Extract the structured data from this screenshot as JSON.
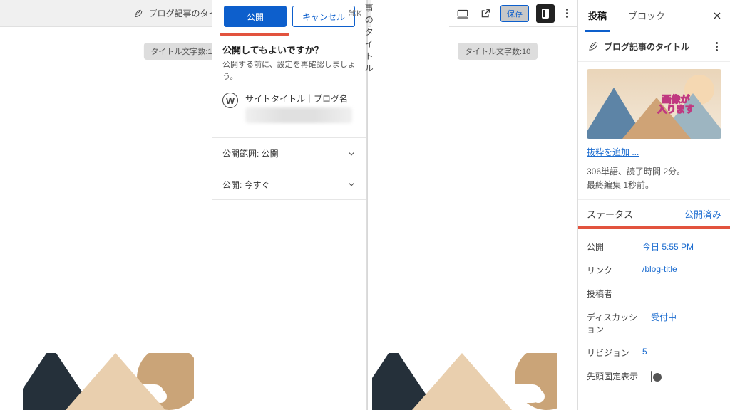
{
  "topbar": {
    "title": "ブログ記事のタイトル",
    "shortcut": "⌘K"
  },
  "counter": "タイトル文字数:10",
  "prepublish": {
    "publish_btn": "公開",
    "cancel_btn": "キャンセル",
    "question": "公開してもよいですか？",
    "hint": "公開する前に、設定を再確認しましょう。",
    "site_title": "サイトタイトル｜ブログ名",
    "rows": {
      "visibility": "公開範囲: 公開",
      "schedule": "公開: 今すぐ"
    }
  },
  "toolbar": {
    "save": "保存"
  },
  "sidebar": {
    "tabs": {
      "post": "投稿",
      "block": "ブロック"
    },
    "post_title": "ブログ記事のタイトル",
    "thumb_caption": "画像が\n入ります",
    "excerpt_link": "抜粋を追加 ...",
    "word_count": "306単語、読了時間 2分。",
    "last_edit": "最終編集 1秒前。",
    "status_label": "ステータス",
    "status_value": "公開済み",
    "fields": {
      "publish_l": "公開",
      "publish_v": "今日 5:55 PM",
      "link_l": "リンク",
      "link_v": "/blog-title",
      "author_l": "投稿者",
      "disc_l": "ディスカッション",
      "disc_v": "受付中",
      "rev_l": "リビジョン",
      "rev_v": "5",
      "sticky_l": "先頭固定表示"
    }
  }
}
